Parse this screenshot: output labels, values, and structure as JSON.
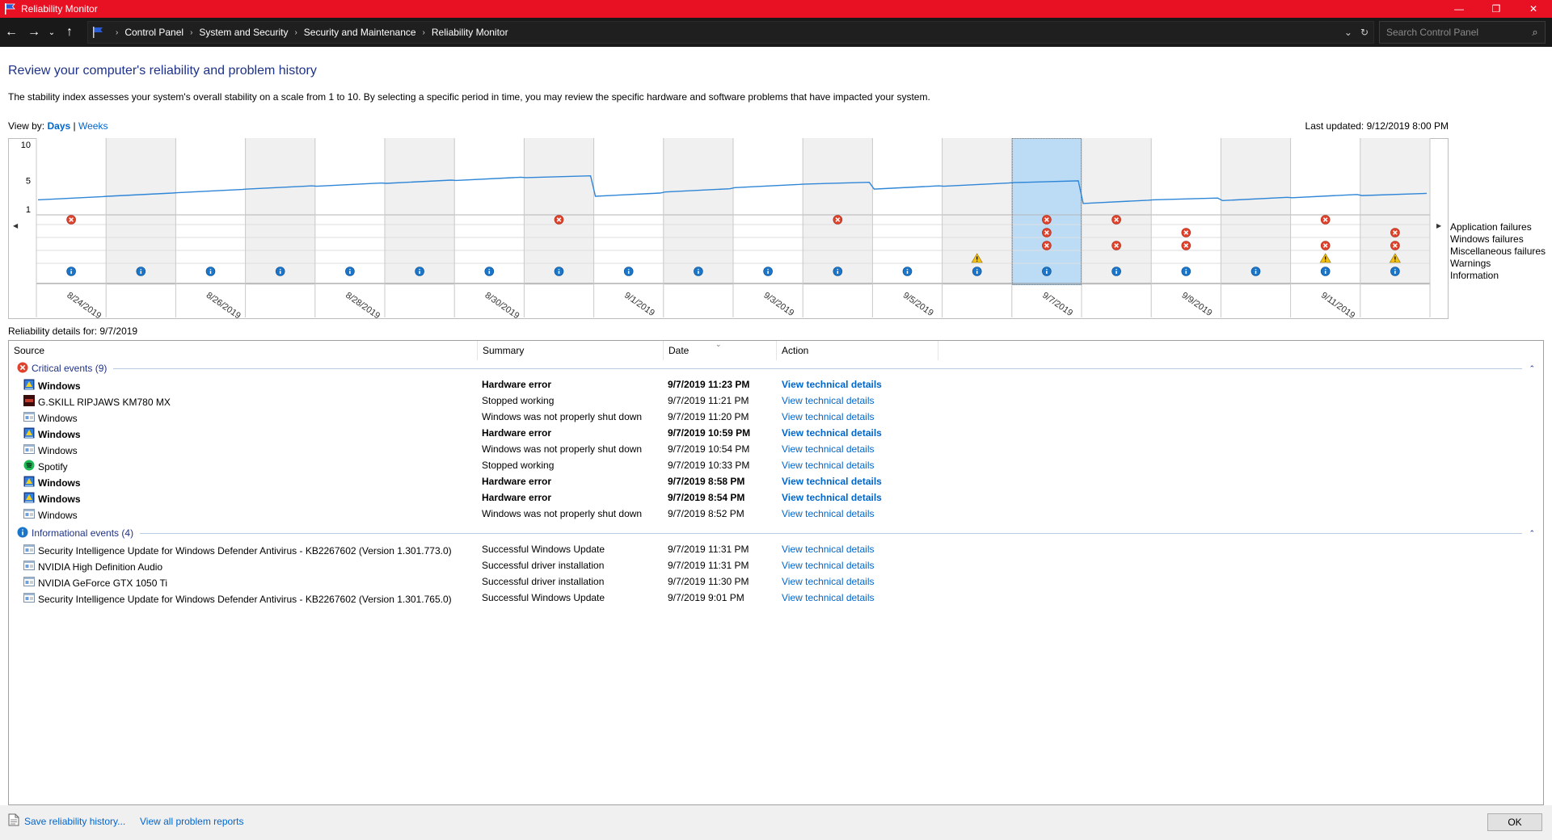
{
  "window": {
    "title": "Reliability Monitor",
    "controls": {
      "minimize": "—",
      "restore": "❐",
      "close": "✕"
    }
  },
  "addressbar": {
    "breadcrumbs": [
      "Control Panel",
      "System and Security",
      "Security and Maintenance",
      "Reliability Monitor"
    ],
    "search_placeholder": "Search Control Panel"
  },
  "header": {
    "title": "Review your computer's reliability and problem history",
    "description": "The stability index assesses your system's overall stability on a scale from 1 to 10. By selecting a specific period in time, you may review the specific hardware and software problems that have impacted your system.",
    "view_by_label": "View by:",
    "view_days": "Days",
    "view_separator": "|",
    "view_weeks": "Weeks",
    "last_updated": "Last updated: 9/12/2019 8:00 PM"
  },
  "chart_data": {
    "type": "line",
    "y_ticks": [
      "10",
      "5",
      "1"
    ],
    "ylim": [
      1,
      10
    ],
    "dates": [
      "8/24/2019",
      "8/25/2019",
      "8/26/2019",
      "8/27/2019",
      "8/28/2019",
      "8/29/2019",
      "8/30/2019",
      "8/31/2019",
      "9/1/2019",
      "9/2/2019",
      "9/3/2019",
      "9/4/2019",
      "9/5/2019",
      "9/6/2019",
      "9/7/2019",
      "9/8/2019",
      "9/9/2019",
      "9/10/2019",
      "9/11/2019",
      "9/12/2019"
    ],
    "x_tick_labels": [
      "8/24/2019",
      "8/26/2019",
      "8/28/2019",
      "8/30/2019",
      "9/1/2019",
      "9/3/2019",
      "9/5/2019",
      "9/7/2019",
      "9/9/2019",
      "9/11/2019"
    ],
    "selected_date": "9/7/2019",
    "stability_index": [
      2.3,
      2.8,
      3.3,
      3.8,
      4.2,
      4.6,
      5.0,
      5.4,
      2.8,
      3.4,
      4.0,
      4.5,
      3.8,
      4.2,
      4.7,
      1.8,
      2.3,
      2.2,
      2.6,
      2.9
    ],
    "legend": [
      "Application failures",
      "Windows failures",
      "Miscellaneous failures",
      "Warnings",
      "Information"
    ],
    "events": {
      "application_failures": [
        "8/24/2019",
        "8/31/2019",
        "9/4/2019",
        "9/7/2019",
        "9/8/2019",
        "9/11/2019"
      ],
      "windows_failures": [
        "9/7/2019",
        "9/9/2019",
        "9/12/2019"
      ],
      "miscellaneous_failures": [
        "9/7/2019",
        "9/8/2019",
        "9/9/2019",
        "9/11/2019",
        "9/12/2019"
      ],
      "warnings": [
        "9/6/2019",
        "9/11/2019",
        "9/12/2019"
      ],
      "information": [
        "8/24/2019",
        "8/25/2019",
        "8/26/2019",
        "8/27/2019",
        "8/28/2019",
        "8/29/2019",
        "8/30/2019",
        "8/31/2019",
        "9/1/2019",
        "9/2/2019",
        "9/3/2019",
        "9/4/2019",
        "9/5/2019",
        "9/6/2019",
        "9/7/2019",
        "9/8/2019",
        "9/9/2019",
        "9/10/2019",
        "9/11/2019",
        "9/12/2019"
      ]
    }
  },
  "details": {
    "label": "Reliability details for: 9/7/2019",
    "columns": [
      "Source",
      "Summary",
      "Date",
      "Action"
    ],
    "critical_title": "Critical events (9)",
    "informational_title": "Informational events (4)",
    "critical_events": [
      {
        "icon": "windows-hw-icon",
        "source": "Windows",
        "summary": "Hardware error",
        "date": "9/7/2019 11:23 PM",
        "action": "View technical details",
        "bold": true
      },
      {
        "icon": "keyboard-app-icon",
        "source": "G.SKILL RIPJAWS KM780 MX",
        "summary": "Stopped working",
        "date": "9/7/2019 11:21 PM",
        "action": "View technical details",
        "bold": false
      },
      {
        "icon": "generic-app-icon",
        "source": "Windows",
        "summary": "Windows was not properly shut down",
        "date": "9/7/2019 11:20 PM",
        "action": "View technical details",
        "bold": false
      },
      {
        "icon": "windows-hw-icon",
        "source": "Windows",
        "summary": "Hardware error",
        "date": "9/7/2019 10:59 PM",
        "action": "View technical details",
        "bold": true
      },
      {
        "icon": "generic-app-icon",
        "source": "Windows",
        "summary": "Windows was not properly shut down",
        "date": "9/7/2019 10:54 PM",
        "action": "View technical details",
        "bold": false
      },
      {
        "icon": "spotify-icon",
        "source": "Spotify",
        "summary": "Stopped working",
        "date": "9/7/2019 10:33 PM",
        "action": "View technical details",
        "bold": false
      },
      {
        "icon": "windows-hw-icon",
        "source": "Windows",
        "summary": "Hardware error",
        "date": "9/7/2019 8:58 PM",
        "action": "View technical details",
        "bold": true
      },
      {
        "icon": "windows-hw-icon",
        "source": "Windows",
        "summary": "Hardware error",
        "date": "9/7/2019 8:54 PM",
        "action": "View technical details",
        "bold": true
      },
      {
        "icon": "generic-app-icon",
        "source": "Windows",
        "summary": "Windows was not properly shut down",
        "date": "9/7/2019 8:52 PM",
        "action": "View technical details",
        "bold": false
      }
    ],
    "informational_events": [
      {
        "icon": "generic-app-icon",
        "source": "Security Intelligence Update for Windows Defender Antivirus - KB2267602 (Version 1.301.773.0)",
        "summary": "Successful Windows Update",
        "date": "9/7/2019 11:31 PM",
        "action": "View technical details",
        "bold": false
      },
      {
        "icon": "generic-app-icon",
        "source": "NVIDIA High Definition Audio",
        "summary": "Successful driver installation",
        "date": "9/7/2019 11:31 PM",
        "action": "View technical details",
        "bold": false
      },
      {
        "icon": "generic-app-icon",
        "source": "NVIDIA GeForce GTX 1050 Ti",
        "summary": "Successful driver installation",
        "date": "9/7/2019 11:30 PM",
        "action": "View technical details",
        "bold": false
      },
      {
        "icon": "generic-app-icon",
        "source": "Security Intelligence Update for Windows Defender Antivirus - KB2267602 (Version 1.301.765.0)",
        "summary": "Successful Windows Update",
        "date": "9/7/2019 9:01 PM",
        "action": "View technical details",
        "bold": false
      }
    ]
  },
  "footer": {
    "save_history": "Save reliability history...",
    "view_all": "View all problem reports",
    "ok": "OK"
  },
  "colors": {
    "titlebar": "#e81123",
    "link": "#0066cc",
    "heading": "#1e3287",
    "line": "#2f86d6",
    "selection": "#bcdcf6",
    "error": "#e0432c",
    "info": "#1b75c9",
    "warning": "#f5c211"
  }
}
